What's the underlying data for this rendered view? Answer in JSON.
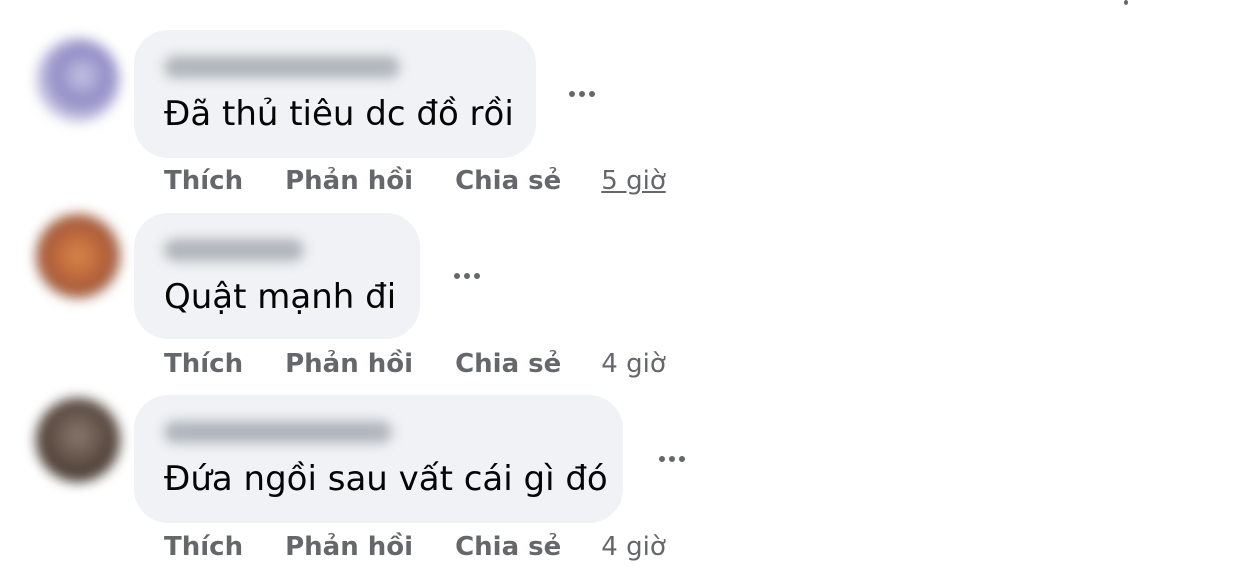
{
  "comments": [
    {
      "text": "Đã thủ tiêu dc đồ rồi",
      "actions": {
        "like": "Thích",
        "reply": "Phản hồi",
        "share": "Chia sẻ"
      },
      "time": "5 giờ"
    },
    {
      "text": "Quật mạnh đi",
      "actions": {
        "like": "Thích",
        "reply": "Phản hồi",
        "share": "Chia sẻ"
      },
      "time": "4 giờ"
    },
    {
      "text": "Đứa ngồi sau vất cái gì đó",
      "actions": {
        "like": "Thích",
        "reply": "Phản hồi",
        "share": "Chia sẻ"
      },
      "time": "4 giờ"
    }
  ],
  "icons": {
    "more": "more-options-icon"
  }
}
